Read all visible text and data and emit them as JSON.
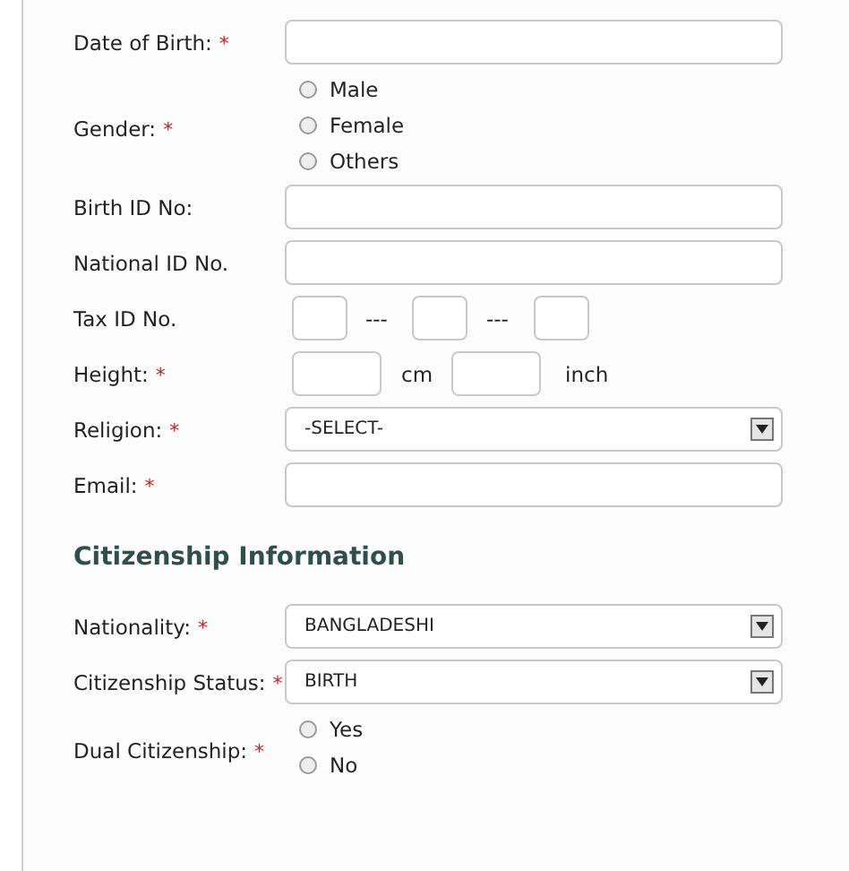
{
  "personal_fields": [
    {
      "kind": "text",
      "label": "Date of Birth:",
      "required_mark": "*"
    },
    {
      "kind": "radio",
      "label": "Gender:",
      "required_mark": "*",
      "options": [
        {
          "label": "Male",
          "selected": false
        },
        {
          "label": "Female",
          "selected": false
        },
        {
          "label": "Others",
          "selected": false
        }
      ]
    },
    {
      "kind": "text",
      "label": "Birth ID No:"
    },
    {
      "kind": "text",
      "label": "National ID No."
    },
    {
      "kind": "taxid",
      "label": "Tax ID No.",
      "separators": [
        "---",
        "---"
      ]
    },
    {
      "kind": "height",
      "label": "Height:",
      "required_mark": "*",
      "units": [
        "cm",
        "inch"
      ]
    },
    {
      "kind": "select",
      "label": "Religion:",
      "required_mark": "*",
      "value": "-SELECT-"
    },
    {
      "kind": "text",
      "label": "Email:",
      "required_mark": "*"
    }
  ],
  "citizenship": {
    "heading": "Citizenship Information",
    "fields": [
      {
        "kind": "select",
        "label": "Nationality:",
        "required_mark": "*",
        "value": "BANGLADESHI"
      },
      {
        "kind": "select",
        "label": "Citizenship Status:",
        "required_mark": "*",
        "value": "BIRTH"
      },
      {
        "kind": "radio",
        "label": "Dual Citizenship:",
        "required_mark": "*",
        "options": [
          {
            "label": "Yes",
            "selected": false
          },
          {
            "label": "No",
            "selected": false
          }
        ]
      }
    ]
  }
}
